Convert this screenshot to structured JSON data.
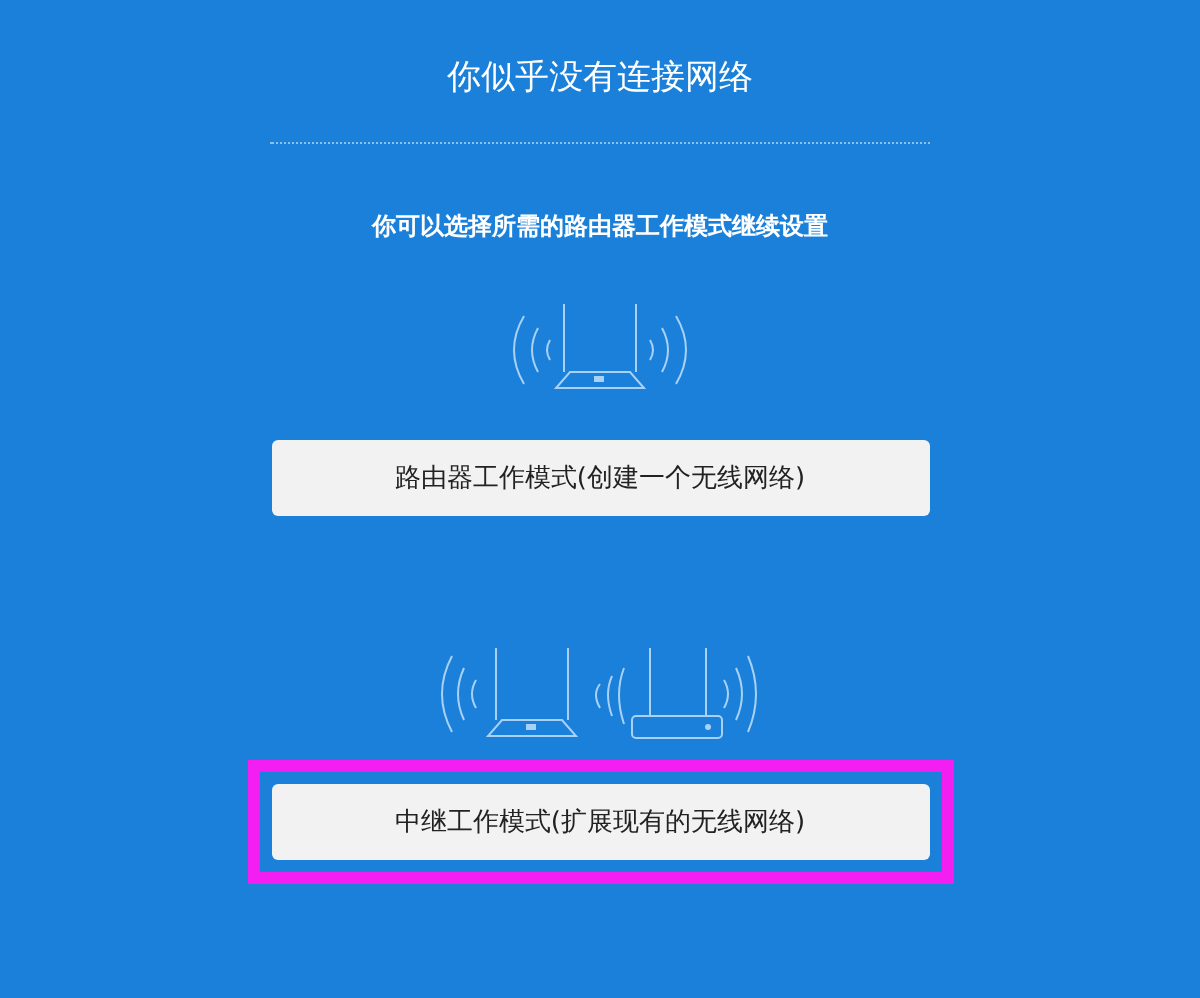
{
  "title": "你似乎没有连接网络",
  "subtitle": "你可以选择所需的路由器工作模式继续设置",
  "modes": [
    {
      "kind": "router",
      "label": "路由器工作模式(创建一个无线网络)",
      "highlighted": false
    },
    {
      "kind": "repeater",
      "label": "中继工作模式(扩展现有的无线网络)",
      "highlighted": true
    }
  ]
}
